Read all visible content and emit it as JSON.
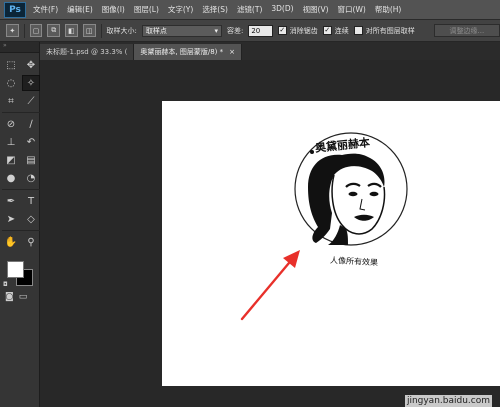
{
  "app": {
    "logo": "Ps"
  },
  "menu": [
    "文件(F)",
    "编辑(E)",
    "图像(I)",
    "图层(L)",
    "文字(Y)",
    "选择(S)",
    "滤镜(T)",
    "3D(D)",
    "视图(V)",
    "窗口(W)",
    "帮助(H)"
  ],
  "options": {
    "sample_size_label": "取样大小:",
    "sample_size_value": "取样点",
    "tolerance_label": "容差:",
    "tolerance_value": "20",
    "antialias_label": "消除锯齿",
    "antialias_checked": true,
    "contiguous_label": "连续",
    "contiguous_checked": true,
    "all_layers_label": "对所有图层取样",
    "all_layers_checked": false,
    "refine_edge_label": "调整边缘..."
  },
  "tabs": [
    {
      "label": "未标题-1.psd @ 33.3% (",
      "close": "×"
    },
    {
      "label": "奥黛丽赫本, 图层蒙版/8) *",
      "close": "×"
    }
  ],
  "stamp": {
    "top_text": "奥黛丽赫本",
    "bottom_text": "人像所有效果"
  },
  "colors": {
    "arrow": "#e8302a",
    "foreground": "#ffffff",
    "background": "#000000"
  },
  "watermark": "jingyan.baidu.com"
}
